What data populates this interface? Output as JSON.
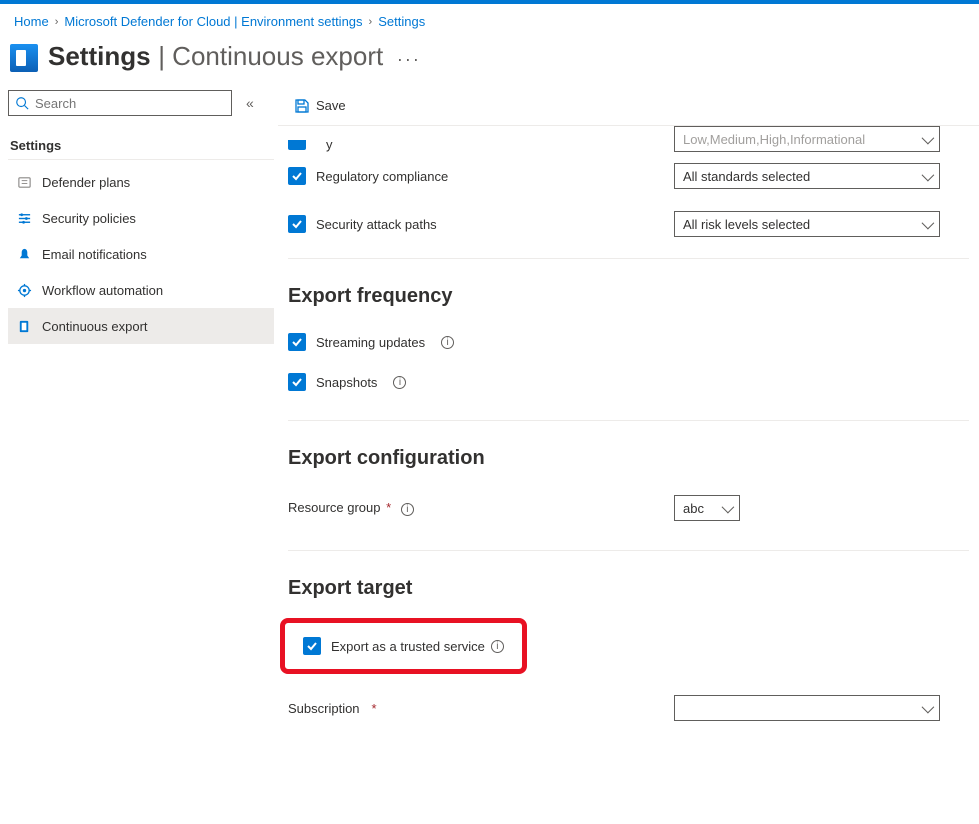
{
  "breadcrumb": {
    "home": "Home",
    "b1": "Microsoft Defender for Cloud | Environment settings",
    "b2": "Settings"
  },
  "header": {
    "title": "Settings",
    "subtitle": "| Continuous export"
  },
  "search": {
    "placeholder": "Search"
  },
  "sidebar": {
    "section": "Settings",
    "items": [
      {
        "label": "Defender plans"
      },
      {
        "label": "Security policies"
      },
      {
        "label": "Email notifications"
      },
      {
        "label": "Workflow automation"
      },
      {
        "label": "Continuous export"
      }
    ]
  },
  "toolbar": {
    "save": "Save"
  },
  "form": {
    "partial_label": "y",
    "severity_dd": "Low,Medium,High,Informational",
    "reg_compliance": "Regulatory compliance",
    "standards_dd": "All standards selected",
    "attack_paths": "Security attack paths",
    "risk_dd": "All risk levels selected",
    "freq_h": "Export frequency",
    "streaming": "Streaming updates",
    "snapshots": "Snapshots",
    "config_h": "Export configuration",
    "resource_group": "Resource group",
    "rg_value": "abc",
    "target_h": "Export target",
    "trusted": "Export as a trusted service",
    "subscription": "Subscription"
  }
}
